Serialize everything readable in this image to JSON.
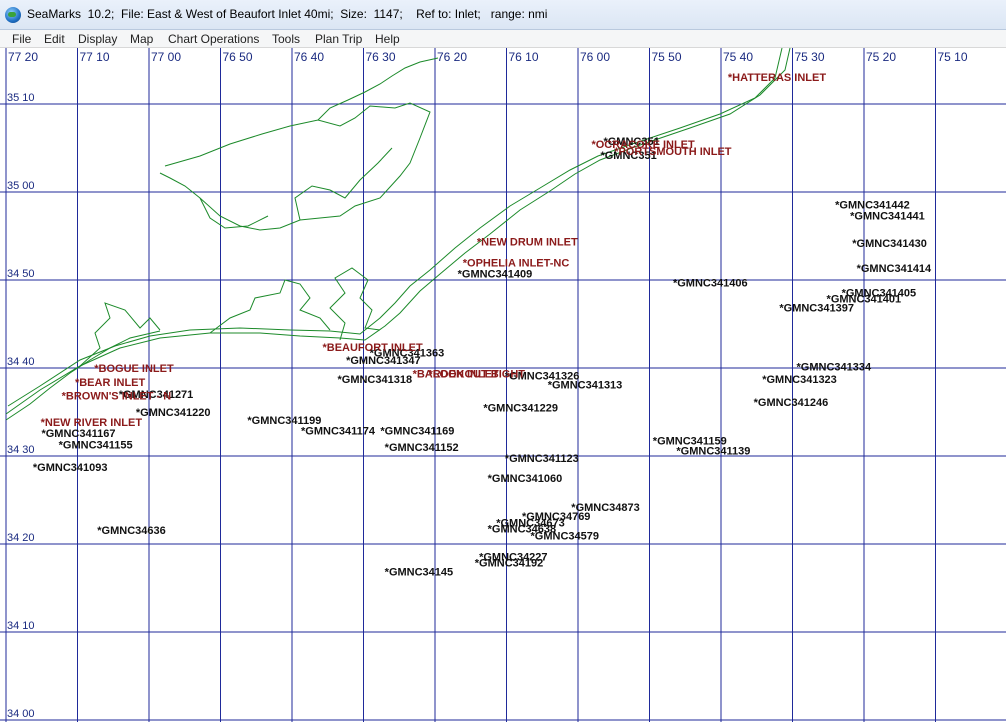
{
  "window": {
    "title": "SeaMarks  10.2;  File: East & West of Beaufort Inlet 40mi;  Size:  1147;    Ref to: Inlet;   range: nmi"
  },
  "menu": [
    "File",
    "Edit",
    "Display",
    "Map",
    "Chart Operations",
    "Tools",
    "Plan Trip",
    "Help"
  ],
  "colors": {
    "grid": "#1f2a9a",
    "coast": "#1c8a2a",
    "inlet": "#8b1a1a",
    "marker": "#111111"
  },
  "axes": {
    "lon_labels": [
      "77 20",
      "77 10",
      "77 00",
      "76 50",
      "76 40",
      "76 30",
      "76 20",
      "76 10",
      "76 00",
      "75 50",
      "75 40",
      "75 30",
      "75 20",
      "75 10"
    ],
    "lat_labels": [
      "35 10",
      "35 00",
      "34 50",
      "34 40",
      "34 30",
      "34 20",
      "34 10",
      "34 00"
    ]
  },
  "inlets": [
    {
      "name": "*HATTERAS INLET",
      "lon": -75.72,
      "lat": 35.204
    },
    {
      "name": "*OCRACOKE INLET",
      "lon": -76.038,
      "lat": 35.077
    },
    {
      "name": "*PORTSMOUTH INLET",
      "lon": -75.985,
      "lat": 35.064
    },
    {
      "name": "*NEW DRUM INLET",
      "lon": -76.305,
      "lat": 34.893
    },
    {
      "name": "*OPHELIA INLET-NC",
      "lon": -76.338,
      "lat": 34.853
    },
    {
      "name": "*BEAUFORT INLET",
      "lon": -76.665,
      "lat": 34.693
    },
    {
      "name": "*BARDEN INLET",
      "lon": -76.455,
      "lat": 34.643
    },
    {
      "name": "*LOOKOUT BIGHT",
      "lon": -76.418,
      "lat": 34.643
    },
    {
      "name": "*BOGUE INLET",
      "lon": -77.197,
      "lat": 34.653
    },
    {
      "name": "*BEAR INLET",
      "lon": -77.242,
      "lat": 34.627
    },
    {
      "name": "*BROWN'S INLET - N",
      "lon": -77.273,
      "lat": 34.601
    },
    {
      "name": "*NEW RIVER INLET",
      "lon": -77.322,
      "lat": 34.551
    }
  ],
  "markers": [
    {
      "name": "*GMNC351",
      "lon": -76.01,
      "lat": 35.083
    },
    {
      "name": "*GMNC351",
      "lon": -76.017,
      "lat": 35.056
    },
    {
      "name": "*GMNC341442",
      "lon": -75.47,
      "lat": 34.963
    },
    {
      "name": "*GMNC341441",
      "lon": -75.435,
      "lat": 34.942
    },
    {
      "name": "*GMNC341430",
      "lon": -75.43,
      "lat": 34.89
    },
    {
      "name": "*GMNC341414",
      "lon": -75.42,
      "lat": 34.842
    },
    {
      "name": "*GMNC341409",
      "lon": -76.35,
      "lat": 34.832
    },
    {
      "name": "*GMNC341406",
      "lon": -75.848,
      "lat": 34.815
    },
    {
      "name": "*GMNC341405",
      "lon": -75.455,
      "lat": 34.796
    },
    {
      "name": "*GMNC341401",
      "lon": -75.49,
      "lat": 34.785
    },
    {
      "name": "*GMNC341397",
      "lon": -75.6,
      "lat": 34.768
    },
    {
      "name": "*GMNC341363",
      "lon": -76.555,
      "lat": 34.682
    },
    {
      "name": "*GMNC341347",
      "lon": -76.61,
      "lat": 34.668
    },
    {
      "name": "*GMNC341334",
      "lon": -75.56,
      "lat": 34.656
    },
    {
      "name": "*GMNC341326",
      "lon": -76.24,
      "lat": 34.639
    },
    {
      "name": "*GMNC341323",
      "lon": -75.64,
      "lat": 34.632
    },
    {
      "name": "*GMNC341318",
      "lon": -76.63,
      "lat": 34.632
    },
    {
      "name": "*GMNC341313",
      "lon": -76.14,
      "lat": 34.622
    },
    {
      "name": "*GMNC341271",
      "lon": -77.14,
      "lat": 34.604
    },
    {
      "name": "*GMNC341246",
      "lon": -75.66,
      "lat": 34.589
    },
    {
      "name": "*GMNC341229",
      "lon": -76.29,
      "lat": 34.578
    },
    {
      "name": "*GMNC341220",
      "lon": -77.1,
      "lat": 34.57
    },
    {
      "name": "*GMNC341199",
      "lon": -76.84,
      "lat": 34.555
    },
    {
      "name": "*GMNC341174",
      "lon": -76.715,
      "lat": 34.535
    },
    {
      "name": "*GMNC341169",
      "lon": -76.53,
      "lat": 34.535
    },
    {
      "name": "*GMNC341167",
      "lon": -77.32,
      "lat": 34.53
    },
    {
      "name": "*GMNC341159",
      "lon": -75.895,
      "lat": 34.516
    },
    {
      "name": "*GMNC341155",
      "lon": -77.28,
      "lat": 34.508
    },
    {
      "name": "*GMNC341152",
      "lon": -76.52,
      "lat": 34.503
    },
    {
      "name": "*GMNC341139",
      "lon": -75.84,
      "lat": 34.497
    },
    {
      "name": "*GMNC341123",
      "lon": -76.24,
      "lat": 34.483
    },
    {
      "name": "*GMNC341093",
      "lon": -77.34,
      "lat": 34.466
    },
    {
      "name": "*GMNC341060",
      "lon": -76.28,
      "lat": 34.445
    },
    {
      "name": "*GMNC34873",
      "lon": -76.085,
      "lat": 34.39
    },
    {
      "name": "*GMNC34769",
      "lon": -76.2,
      "lat": 34.373
    },
    {
      "name": "*GMNC34673",
      "lon": -76.26,
      "lat": 34.36
    },
    {
      "name": "*GMNC34638",
      "lon": -76.28,
      "lat": 34.349
    },
    {
      "name": "*GMNC34636",
      "lon": -77.19,
      "lat": 34.346
    },
    {
      "name": "*GMNC34579",
      "lon": -76.18,
      "lat": 34.336
    },
    {
      "name": "*GMNC34227",
      "lon": -76.3,
      "lat": 34.296
    },
    {
      "name": "*GMNC34192",
      "lon": -76.31,
      "lat": 34.285
    },
    {
      "name": "*GMNC34145",
      "lon": -76.52,
      "lat": 34.268
    }
  ]
}
